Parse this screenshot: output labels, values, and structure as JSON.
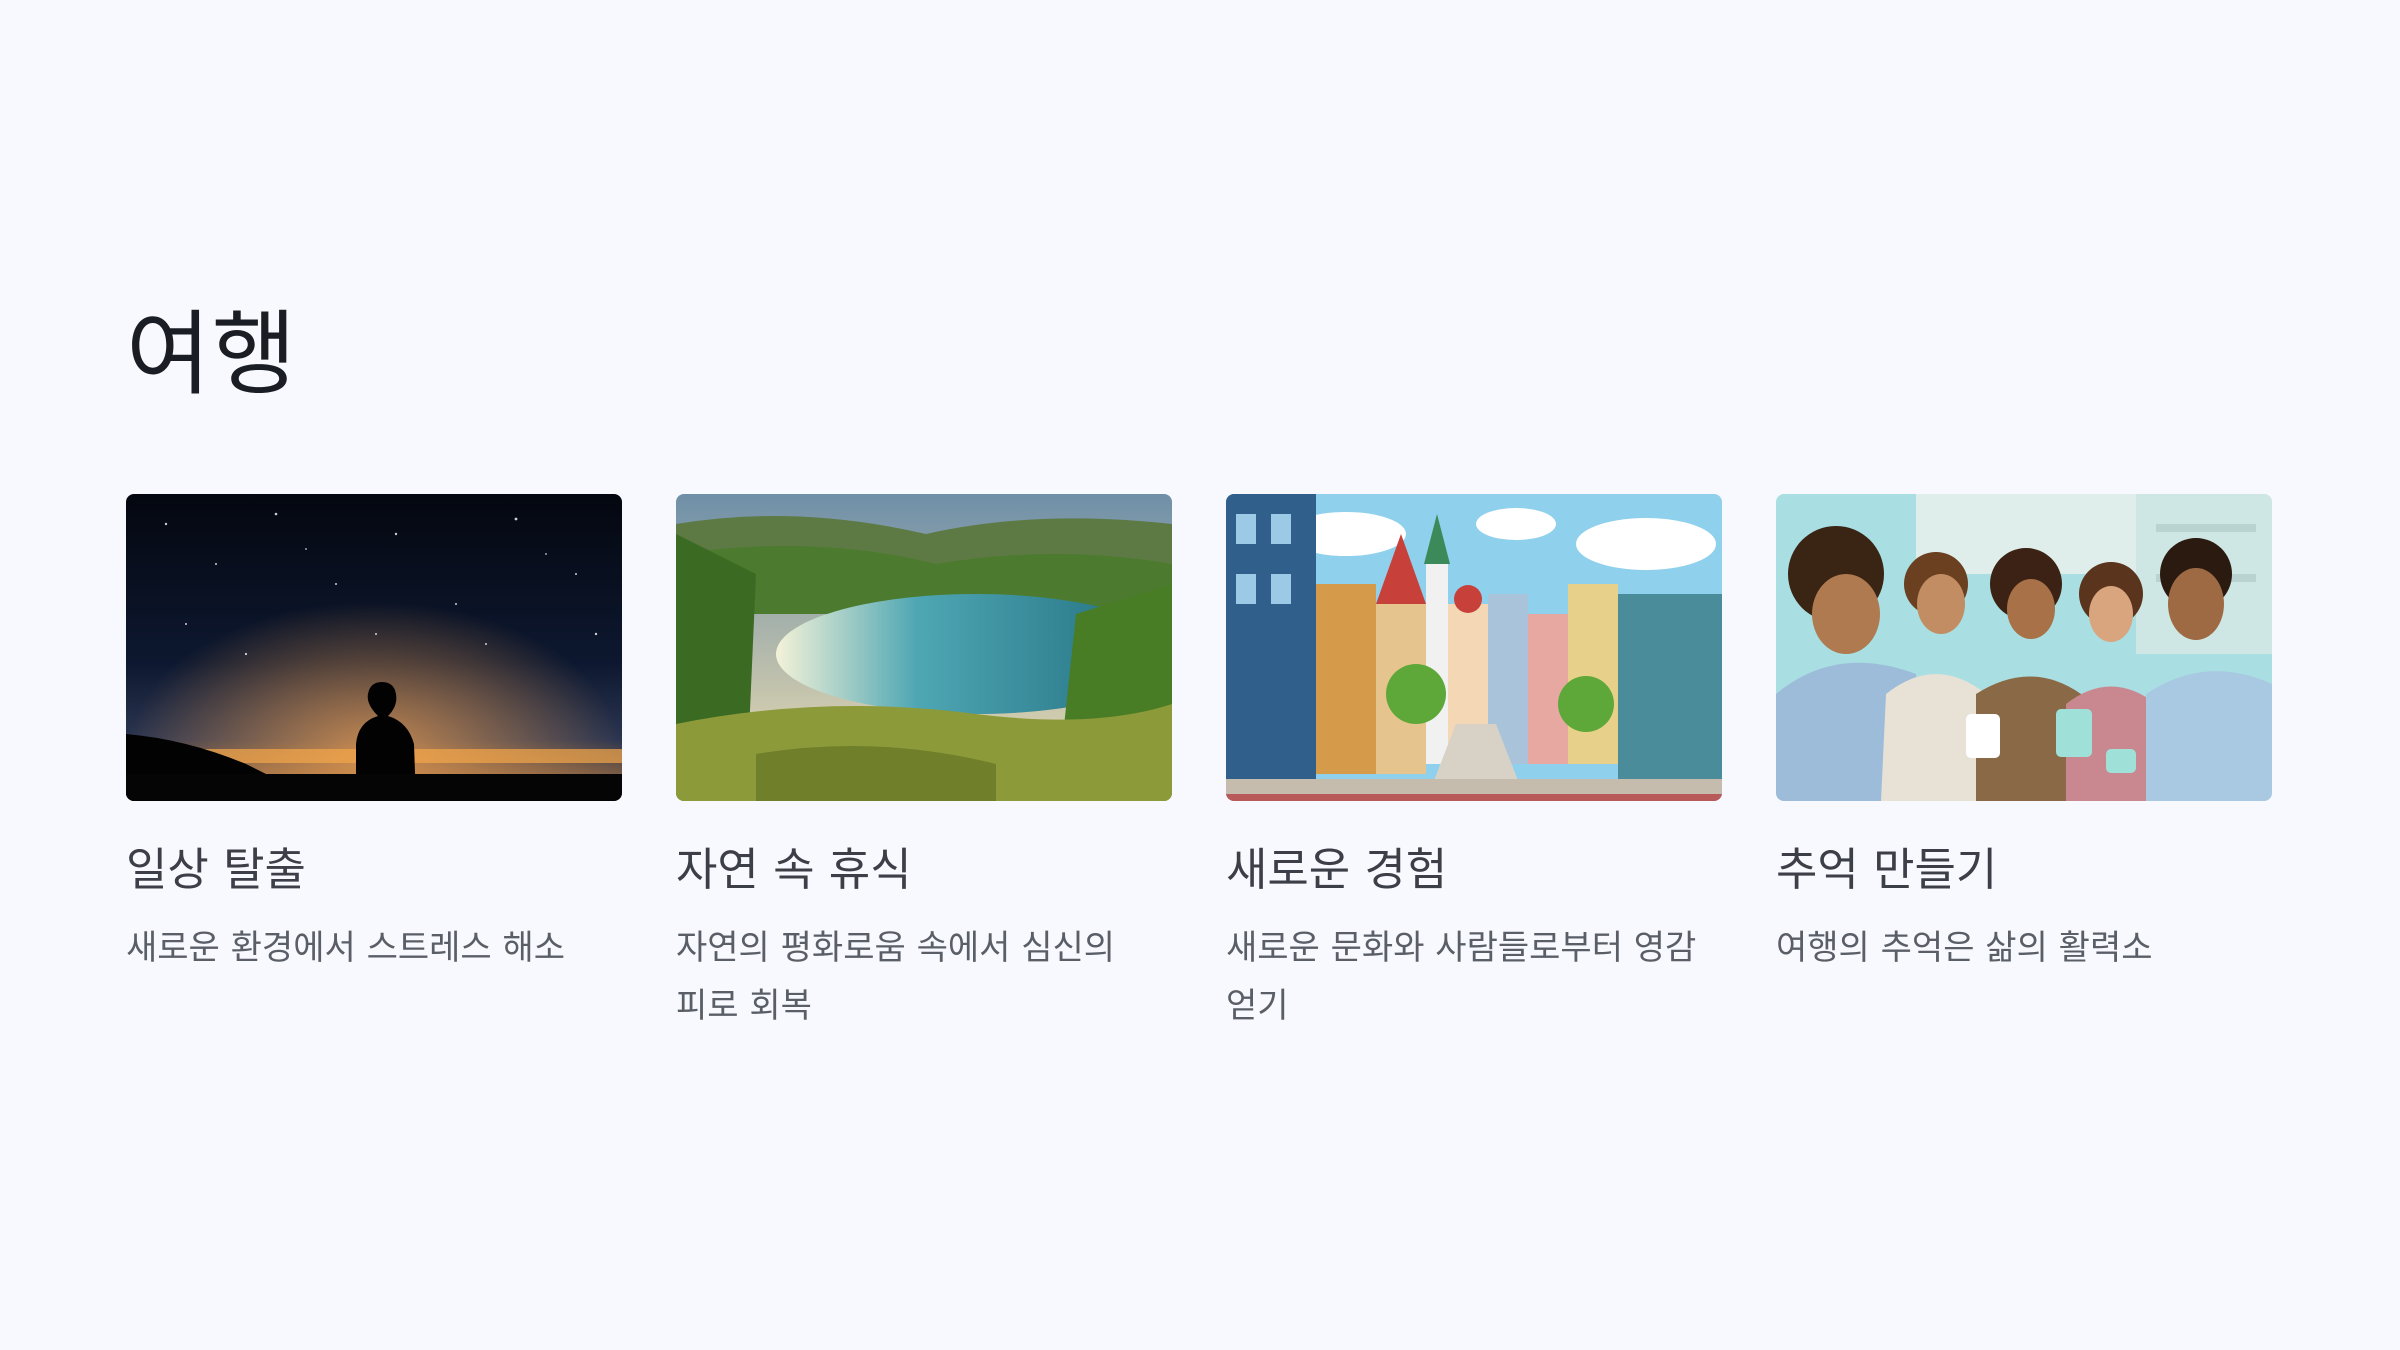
{
  "page": {
    "title": "여행",
    "background": "#f8f9fe"
  },
  "cards": [
    {
      "title": "일상 탈출",
      "description": "새로운 환경에서 스트레스 해소",
      "image_subject": "night sky over city lights with silhouette"
    },
    {
      "title": "자연 속 휴식",
      "description": "자연의 평화로움 속에서 심신의 피로 회복",
      "image_subject": "lake surrounded by green hills"
    },
    {
      "title": "새로운 경험",
      "description": "새로운 문화와 사람들로부터 영감 얻기",
      "image_subject": "illustrated colorful city street"
    },
    {
      "title": "추억 만들기",
      "description": "여행의 추억은 삶의 활력소",
      "image_subject": "friends laughing at a cafe"
    }
  ]
}
